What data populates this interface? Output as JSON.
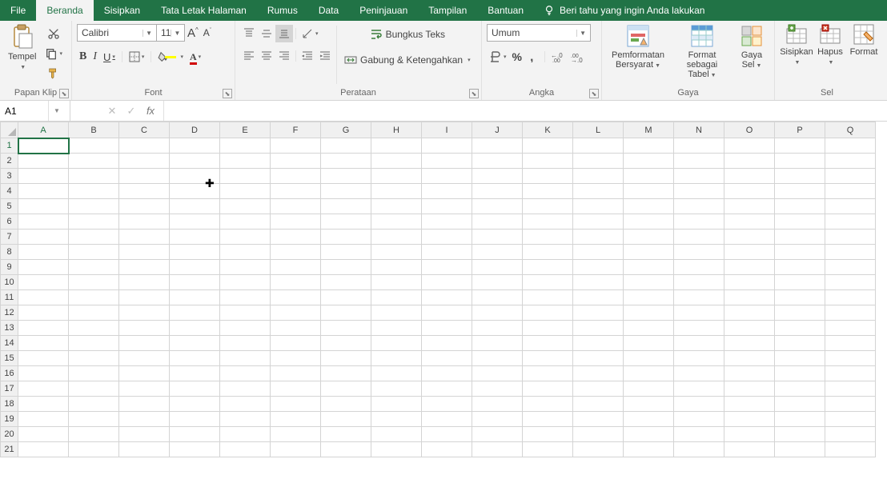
{
  "menu": {
    "items": [
      "File",
      "Beranda",
      "Sisipkan",
      "Tata Letak Halaman",
      "Rumus",
      "Data",
      "Peninjauan",
      "Tampilan",
      "Bantuan"
    ],
    "active_index": 1,
    "tellme": "Beri tahu yang ingin Anda lakukan"
  },
  "ribbon": {
    "clipboard": {
      "paste": "Tempel",
      "label": "Papan Klip"
    },
    "font": {
      "name": "Calibri",
      "size": "11",
      "label": "Font",
      "bold": "B",
      "italic": "I",
      "underline": "U",
      "grow": "A",
      "shrink": "A"
    },
    "alignment": {
      "wrap": "Bungkus Teks",
      "merge": "Gabung & Ketengahkan",
      "label": "Perataan"
    },
    "number": {
      "format": "Umum",
      "label": "Angka",
      "percent": "%"
    },
    "styles": {
      "cond": "Pemformatan Bersyarat",
      "table": "Format sebagai Tabel",
      "cell": "Gaya Sel",
      "label": "Gaya"
    },
    "cells": {
      "insert": "Sisipkan",
      "delete": "Hapus",
      "format": "Format",
      "label": "Sel"
    }
  },
  "formula": {
    "namebox": "A1",
    "fx": "fx",
    "value": ""
  },
  "grid": {
    "columns": [
      "A",
      "B",
      "C",
      "D",
      "E",
      "F",
      "G",
      "H",
      "I",
      "J",
      "K",
      "L",
      "M",
      "N",
      "O",
      "P",
      "Q"
    ],
    "rows": 21,
    "selected_cell": "A1"
  }
}
